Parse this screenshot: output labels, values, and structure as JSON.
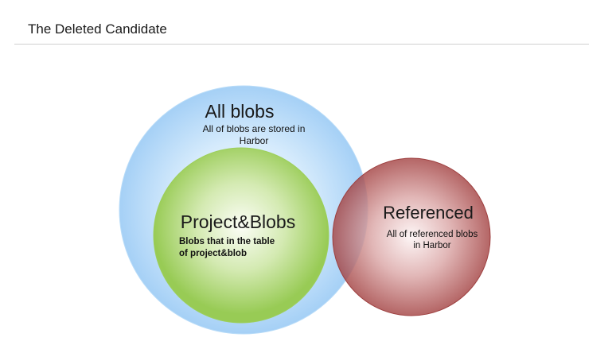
{
  "header": {
    "title": "The Deleted Candidate"
  },
  "diagram": {
    "all_blobs": {
      "title": "All blobs",
      "desc_line1": "All of blobs are stored in",
      "desc_line2": "Harbor",
      "color": "#a9d3f7"
    },
    "project_blobs": {
      "title": "Project&Blobs",
      "desc_line1": "Blobs that in the table",
      "desc_line2": "of project&blob",
      "color": "#9dcf5a"
    },
    "referenced": {
      "title": "Referenced",
      "desc_line1": "All of referenced blobs",
      "desc_line2": "in Harbor",
      "color": "#a84848"
    }
  }
}
